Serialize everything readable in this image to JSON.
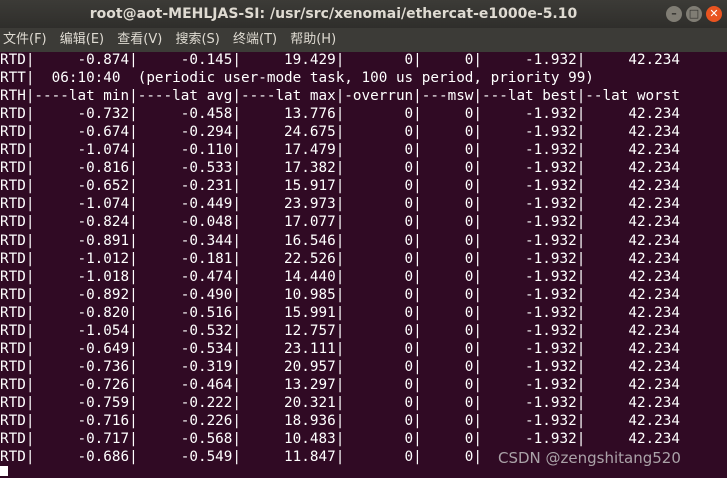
{
  "window": {
    "title": "root@aot-MEHLJAS-SI: /usr/src/xenomai/ethercat-e1000e-5.10",
    "minimize_glyph": "–",
    "maximize_glyph": "□",
    "close_glyph": "✕"
  },
  "menu": [
    {
      "label": "文件(F)"
    },
    {
      "label": "编辑(E)"
    },
    {
      "label": "查看(V)"
    },
    {
      "label": "搜索(S)"
    },
    {
      "label": "终端(T)"
    },
    {
      "label": "帮助(H)"
    }
  ],
  "terminal": {
    "background": "#300a24",
    "foreground": "#ffffff",
    "lines": [
      "RTD|     -0.874|     -0.145|     19.429|       0|     0|     -1.932|     42.234",
      "RTT|  06:10:40  (periodic user-mode task, 100 us period, priority 99)",
      "RTH|----lat min|----lat avg|----lat max|-overrun|---msw|---lat best|--lat worst",
      "RTD|     -0.732|     -0.458|     13.776|       0|     0|     -1.932|     42.234",
      "RTD|     -0.674|     -0.294|     24.675|       0|     0|     -1.932|     42.234",
      "RTD|     -1.074|     -0.110|     17.479|       0|     0|     -1.932|     42.234",
      "RTD|     -0.816|     -0.533|     17.382|       0|     0|     -1.932|     42.234",
      "RTD|     -0.652|     -0.231|     15.917|       0|     0|     -1.932|     42.234",
      "RTD|     -1.074|     -0.449|     23.973|       0|     0|     -1.932|     42.234",
      "RTD|     -0.824|     -0.048|     17.077|       0|     0|     -1.932|     42.234",
      "RTD|     -0.891|     -0.344|     16.546|       0|     0|     -1.932|     42.234",
      "RTD|     -1.012|     -0.181|     22.526|       0|     0|     -1.932|     42.234",
      "RTD|     -1.018|     -0.474|     14.440|       0|     0|     -1.932|     42.234",
      "RTD|     -0.892|     -0.490|     10.985|       0|     0|     -1.932|     42.234",
      "RTD|     -0.820|     -0.516|     15.991|       0|     0|     -1.932|     42.234",
      "RTD|     -1.054|     -0.532|     12.757|       0|     0|     -1.932|     42.234",
      "RTD|     -0.649|     -0.534|     23.111|       0|     0|     -1.932|     42.234",
      "RTD|     -0.736|     -0.319|     20.957|       0|     0|     -1.932|     42.234",
      "RTD|     -0.726|     -0.464|     13.297|       0|     0|     -1.932|     42.234",
      "RTD|     -0.759|     -0.222|     20.321|       0|     0|     -1.932|     42.234",
      "RTD|     -0.716|     -0.226|     18.936|       0|     0|     -1.932|     42.234",
      "RTD|     -0.717|     -0.568|     10.483|       0|     0|     -1.932|     42.234",
      "RTD|     -0.686|     -0.549|     11.847|       0|     0|"
    ]
  },
  "watermark": "CSDN @zengshitang520"
}
